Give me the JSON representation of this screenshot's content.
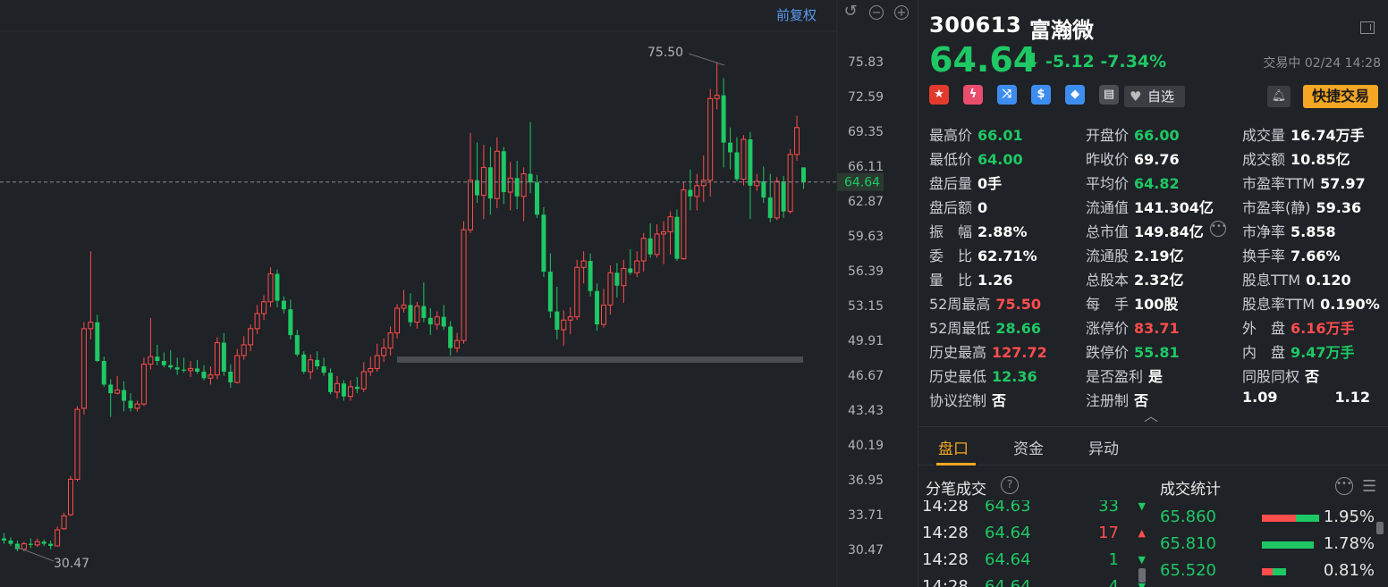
{
  "chart": {
    "restore_label": "前复权",
    "high_label": "75.50",
    "low_label": "30.47",
    "current_price_label": "64.64",
    "y_ticks": [
      "75.83",
      "72.59",
      "69.35",
      "66.11",
      "62.87",
      "59.63",
      "56.39",
      "53.15",
      "49.91",
      "46.67",
      "43.43",
      "40.19",
      "36.95",
      "33.71",
      "30.47"
    ],
    "colors": {
      "up": "#ff4d4d",
      "down": "#1ec865",
      "bg": "#1f2226"
    }
  },
  "chart_data": {
    "type": "candlestick",
    "ylim": [
      28.9,
      77.6
    ],
    "candles": [
      [
        31.5,
        32.0,
        31.0,
        31.3
      ],
      [
        31.3,
        31.6,
        30.8,
        31.0
      ],
      [
        31.0,
        31.3,
        30.3,
        30.5
      ],
      [
        30.5,
        31.2,
        30.3,
        31.0
      ],
      [
        31.0,
        31.5,
        30.6,
        30.9
      ],
      [
        30.9,
        31.5,
        30.7,
        31.2
      ],
      [
        31.2,
        31.4,
        30.8,
        31.0
      ],
      [
        31.0,
        31.3,
        30.5,
        30.8
      ],
      [
        30.8,
        32.6,
        30.8,
        32.3
      ],
      [
        32.4,
        33.9,
        32.3,
        33.6
      ],
      [
        33.7,
        37.3,
        33.6,
        37.0
      ],
      [
        37.0,
        43.8,
        36.8,
        43.5
      ],
      [
        43.6,
        51.6,
        43.0,
        51.0
      ],
      [
        51.0,
        58.2,
        50.0,
        51.6
      ],
      [
        51.6,
        52.3,
        47.9,
        48.0
      ],
      [
        48.0,
        48.4,
        45.6,
        45.8
      ],
      [
        45.8,
        46.3,
        42.8,
        45.0
      ],
      [
        45.0,
        46.6,
        44.9,
        45.3
      ],
      [
        45.3,
        46.1,
        43.3,
        44.3
      ],
      [
        44.3,
        45.0,
        43.3,
        43.6
      ],
      [
        43.6,
        44.3,
        43.3,
        44.0
      ],
      [
        44.0,
        48.3,
        43.8,
        47.7
      ],
      [
        47.7,
        52.0,
        47.2,
        48.4
      ],
      [
        48.4,
        49.5,
        47.6,
        48.0
      ],
      [
        48.0,
        48.8,
        47.4,
        47.6
      ],
      [
        47.6,
        49.0,
        47.2,
        47.4
      ],
      [
        47.4,
        48.3,
        46.7,
        47.2
      ],
      [
        47.2,
        48.3,
        46.9,
        47.1
      ],
      [
        47.1,
        48.0,
        46.5,
        47.3
      ],
      [
        47.3,
        48.1,
        46.8,
        47.0
      ],
      [
        47.0,
        47.6,
        46.2,
        46.4
      ],
      [
        46.4,
        47.5,
        45.8,
        46.7
      ],
      [
        46.7,
        50.2,
        46.3,
        49.7
      ],
      [
        49.7,
        50.6,
        46.6,
        47.0
      ],
      [
        47.0,
        47.7,
        45.5,
        46.0
      ],
      [
        46.0,
        49.1,
        45.9,
        48.5
      ],
      [
        48.5,
        50.3,
        48.1,
        49.5
      ],
      [
        49.5,
        51.4,
        48.9,
        51.0
      ],
      [
        51.0,
        53.2,
        50.5,
        52.4
      ],
      [
        52.4,
        54.1,
        51.8,
        53.5
      ],
      [
        53.5,
        56.7,
        53.0,
        56.1
      ],
      [
        56.1,
        56.5,
        53.0,
        53.6
      ],
      [
        53.6,
        54.0,
        52.4,
        52.8
      ],
      [
        52.8,
        53.7,
        50.0,
        50.4
      ],
      [
        50.4,
        50.9,
        48.4,
        48.6
      ],
      [
        48.6,
        48.9,
        46.8,
        47.0
      ],
      [
        47.0,
        48.6,
        46.3,
        48.1
      ],
      [
        48.1,
        48.9,
        47.2,
        47.5
      ],
      [
        47.5,
        48.3,
        46.6,
        46.9
      ],
      [
        46.9,
        47.3,
        44.9,
        45.1
      ],
      [
        45.1,
        46.6,
        44.5,
        45.9
      ],
      [
        45.9,
        46.2,
        44.3,
        44.7
      ],
      [
        44.7,
        46.2,
        44.3,
        45.6
      ],
      [
        45.6,
        46.5,
        45.0,
        45.4
      ],
      [
        45.4,
        47.9,
        45.1,
        47.0
      ],
      [
        47.0,
        48.4,
        46.6,
        47.3
      ],
      [
        47.3,
        49.6,
        47.0,
        48.5
      ],
      [
        48.5,
        50.1,
        47.9,
        49.2
      ],
      [
        49.2,
        51.2,
        48.5,
        50.6
      ],
      [
        50.6,
        53.3,
        50.1,
        52.9
      ],
      [
        52.9,
        54.6,
        52.5,
        53.2
      ],
      [
        53.2,
        54.3,
        51.2,
        51.6
      ],
      [
        51.6,
        53.5,
        51.0,
        53.1
      ],
      [
        53.1,
        55.3,
        51.6,
        52.0
      ],
      [
        52.0,
        52.9,
        50.4,
        51.4
      ],
      [
        51.4,
        52.6,
        50.9,
        52.1
      ],
      [
        52.1,
        53.2,
        50.9,
        51.2
      ],
      [
        51.2,
        51.7,
        48.5,
        49.2
      ],
      [
        49.2,
        50.6,
        48.8,
        49.9
      ],
      [
        49.9,
        61.0,
        49.6,
        60.2
      ],
      [
        60.2,
        69.2,
        59.9,
        64.8
      ],
      [
        64.8,
        68.3,
        62.7,
        63.4
      ],
      [
        63.4,
        68.1,
        61.2,
        66.0
      ],
      [
        66.0,
        67.9,
        61.6,
        63.1
      ],
      [
        63.1,
        68.8,
        62.2,
        67.5
      ],
      [
        67.5,
        67.9,
        62.6,
        63.7
      ],
      [
        63.7,
        66.5,
        62.0,
        65.0
      ],
      [
        65.0,
        66.6,
        62.1,
        63.3
      ],
      [
        63.3,
        66.0,
        61.0,
        65.4
      ],
      [
        65.4,
        70.2,
        63.6,
        64.6
      ],
      [
        64.6,
        65.3,
        61.3,
        61.6
      ],
      [
        61.6,
        62.3,
        55.8,
        56.3
      ],
      [
        56.3,
        58.0,
        52.0,
        52.6
      ],
      [
        52.6,
        54.9,
        50.0,
        50.9
      ],
      [
        50.9,
        52.7,
        49.4,
        51.8
      ],
      [
        51.8,
        53.0,
        50.5,
        52.1
      ],
      [
        52.1,
        57.4,
        51.8,
        56.7
      ],
      [
        56.7,
        58.2,
        55.2,
        57.3
      ],
      [
        57.3,
        58.0,
        54.0,
        54.5
      ],
      [
        54.5,
        55.2,
        50.8,
        51.4
      ],
      [
        51.4,
        54.7,
        51.1,
        53.2
      ],
      [
        53.2,
        56.9,
        52.3,
        56.2
      ],
      [
        56.2,
        57.1,
        53.9,
        55.0
      ],
      [
        55.0,
        57.4,
        53.4,
        56.6
      ],
      [
        56.6,
        58.4,
        56.0,
        56.2
      ],
      [
        56.2,
        58.2,
        55.8,
        57.3
      ],
      [
        57.3,
        59.9,
        56.3,
        59.4
      ],
      [
        59.4,
        60.8,
        57.6,
        57.9
      ],
      [
        57.9,
        60.7,
        57.6,
        59.8
      ],
      [
        59.8,
        61.0,
        57.0,
        60.0
      ],
      [
        60.0,
        61.9,
        57.9,
        61.4
      ],
      [
        61.4,
        62.1,
        57.3,
        57.5
      ],
      [
        57.5,
        64.6,
        57.4,
        63.9
      ],
      [
        63.9,
        65.8,
        62.0,
        63.3
      ],
      [
        63.3,
        65.4,
        62.0,
        64.3
      ],
      [
        64.3,
        67.1,
        62.8,
        64.8
      ],
      [
        64.8,
        73.3,
        63.3,
        72.4
      ],
      [
        72.4,
        75.8,
        71.4,
        72.7
      ],
      [
        72.7,
        74.3,
        66.0,
        68.3
      ],
      [
        68.3,
        69.7,
        65.8,
        67.4
      ],
      [
        67.4,
        68.8,
        64.7,
        64.9
      ],
      [
        64.9,
        69.0,
        64.3,
        68.6
      ],
      [
        68.6,
        69.3,
        61.2,
        64.3
      ],
      [
        64.3,
        65.4,
        63.8,
        64.7
      ],
      [
        64.7,
        66.1,
        62.7,
        63.2
      ],
      [
        63.2,
        65.4,
        60.9,
        61.3
      ],
      [
        61.3,
        65.1,
        61.1,
        64.7
      ],
      [
        64.7,
        65.2,
        61.3,
        61.9
      ],
      [
        61.9,
        67.7,
        61.7,
        67.2
      ],
      [
        67.2,
        70.8,
        66.6,
        69.7
      ],
      [
        66.0,
        66.0,
        64.0,
        64.6
      ]
    ]
  },
  "quote": {
    "code": "300613",
    "name": "富瀚微",
    "price": "64.64",
    "change": "-5.12",
    "change_pct": "-7.34%",
    "status": "交易中 02/24 14:28",
    "watch_label": "自选",
    "trade_label": "快捷交易",
    "badges": [
      {
        "icon": "china-flag-icon",
        "color": "#e23b2e",
        "glyph": "★"
      },
      {
        "icon": "lightning-icon",
        "color": "#e84d6b",
        "glyph": "ϟ"
      },
      {
        "icon": "shuffle-icon",
        "color": "#3d8df0",
        "glyph": "⤨"
      },
      {
        "icon": "dollar-icon",
        "color": "#3d8df0",
        "glyph": "$"
      },
      {
        "icon": "tag-icon",
        "color": "#3d8df0",
        "glyph": "◆"
      },
      {
        "icon": "doc-icon",
        "color": "#4a4d52",
        "glyph": "▤"
      }
    ]
  },
  "stats": [
    [
      {
        "k": "最高价",
        "v": "66.01",
        "c": "down"
      },
      {
        "k": "开盘价",
        "v": "66.00",
        "c": "down"
      },
      {
        "k": "成交量",
        "v": "16.74万手",
        "c": "neu"
      }
    ],
    [
      {
        "k": "最低价",
        "v": "64.00",
        "c": "down"
      },
      {
        "k": "昨收价",
        "v": "69.76",
        "c": "neu"
      },
      {
        "k": "成交额",
        "v": "10.85亿",
        "c": "neu"
      }
    ],
    [
      {
        "k": "盘后量",
        "v": "0手",
        "c": "neu"
      },
      {
        "k": "平均价",
        "v": "64.82",
        "c": "down"
      },
      {
        "k": "市盈率TTM",
        "v": "57.97",
        "c": "neu"
      }
    ],
    [
      {
        "k": "盘后额",
        "v": "0",
        "c": "neu"
      },
      {
        "k": "流通值",
        "v": "141.304亿",
        "c": "neu"
      },
      {
        "k": "市盈率(静)",
        "v": "59.36",
        "c": "neu"
      }
    ],
    [
      {
        "k": "振　幅",
        "v": "2.88%",
        "c": "neu"
      },
      {
        "k": "总市值",
        "v": "149.84亿",
        "c": "neu"
      },
      {
        "k": "市净率",
        "v": "5.858",
        "c": "neu"
      }
    ],
    [
      {
        "k": "委　比",
        "v": "62.71%",
        "c": "neu"
      },
      {
        "k": "流通股",
        "v": "2.19亿",
        "c": "neu"
      },
      {
        "k": "换手率",
        "v": "7.66%",
        "c": "neu"
      }
    ],
    [
      {
        "k": "量　比",
        "v": "1.26",
        "c": "neu"
      },
      {
        "k": "总股本",
        "v": "2.32亿",
        "c": "neu"
      },
      {
        "k": "股息TTM",
        "v": "0.120",
        "c": "neu"
      }
    ],
    [
      {
        "k": "52周最高",
        "v": "75.50",
        "c": "up"
      },
      {
        "k": "每　手",
        "v": "100股",
        "c": "neu"
      },
      {
        "k": "股息率TTM",
        "v": "0.190%",
        "c": "neu"
      }
    ],
    [
      {
        "k": "52周最低",
        "v": "28.66",
        "c": "down"
      },
      {
        "k": "涨停价",
        "v": "83.71",
        "c": "up"
      },
      {
        "k": "外　盘",
        "v": "6.16万手",
        "c": "up"
      }
    ],
    [
      {
        "k": "历史最高",
        "v": "127.72",
        "c": "up"
      },
      {
        "k": "跌停价",
        "v": "55.81",
        "c": "down"
      },
      {
        "k": "内　盘",
        "v": "9.47万手",
        "c": "down"
      }
    ],
    [
      {
        "k": "历史最低",
        "v": "12.36",
        "c": "down"
      },
      {
        "k": "是否盈利",
        "v": "是",
        "c": "neu"
      },
      {
        "k": "同股同权",
        "v": "否",
        "c": "neu"
      }
    ],
    [
      {
        "k": "协议控制",
        "v": "否",
        "c": "neu"
      },
      {
        "k": "注册制",
        "v": "否",
        "c": "neu"
      },
      {
        "k": "1.09",
        "v": "1.12",
        "c": "neu"
      }
    ]
  ],
  "tabs": [
    "盘口",
    "资金",
    "异动"
  ],
  "sections": {
    "ticks_title": "分笔成交",
    "volume_title": "成交统计"
  },
  "ticks": [
    {
      "t": "14:28",
      "p": "64.63",
      "q": "33",
      "dir": "down"
    },
    {
      "t": "14:28",
      "p": "64.64",
      "q": "17",
      "dir": "up"
    },
    {
      "t": "14:28",
      "p": "64.64",
      "q": "1",
      "dir": "down"
    },
    {
      "t": "14:28",
      "p": "64.64",
      "q": "4",
      "dir": "down"
    }
  ],
  "volume_stats": [
    {
      "p": "65.860",
      "pct": "1.95%",
      "share": 0.0195,
      "buy_frac": 0.6
    },
    {
      "p": "65.810",
      "pct": "1.78%",
      "share": 0.0178,
      "buy_frac": 0.0
    },
    {
      "p": "65.520",
      "pct": "0.81%",
      "share": 0.0081,
      "buy_frac": 0.45
    }
  ]
}
